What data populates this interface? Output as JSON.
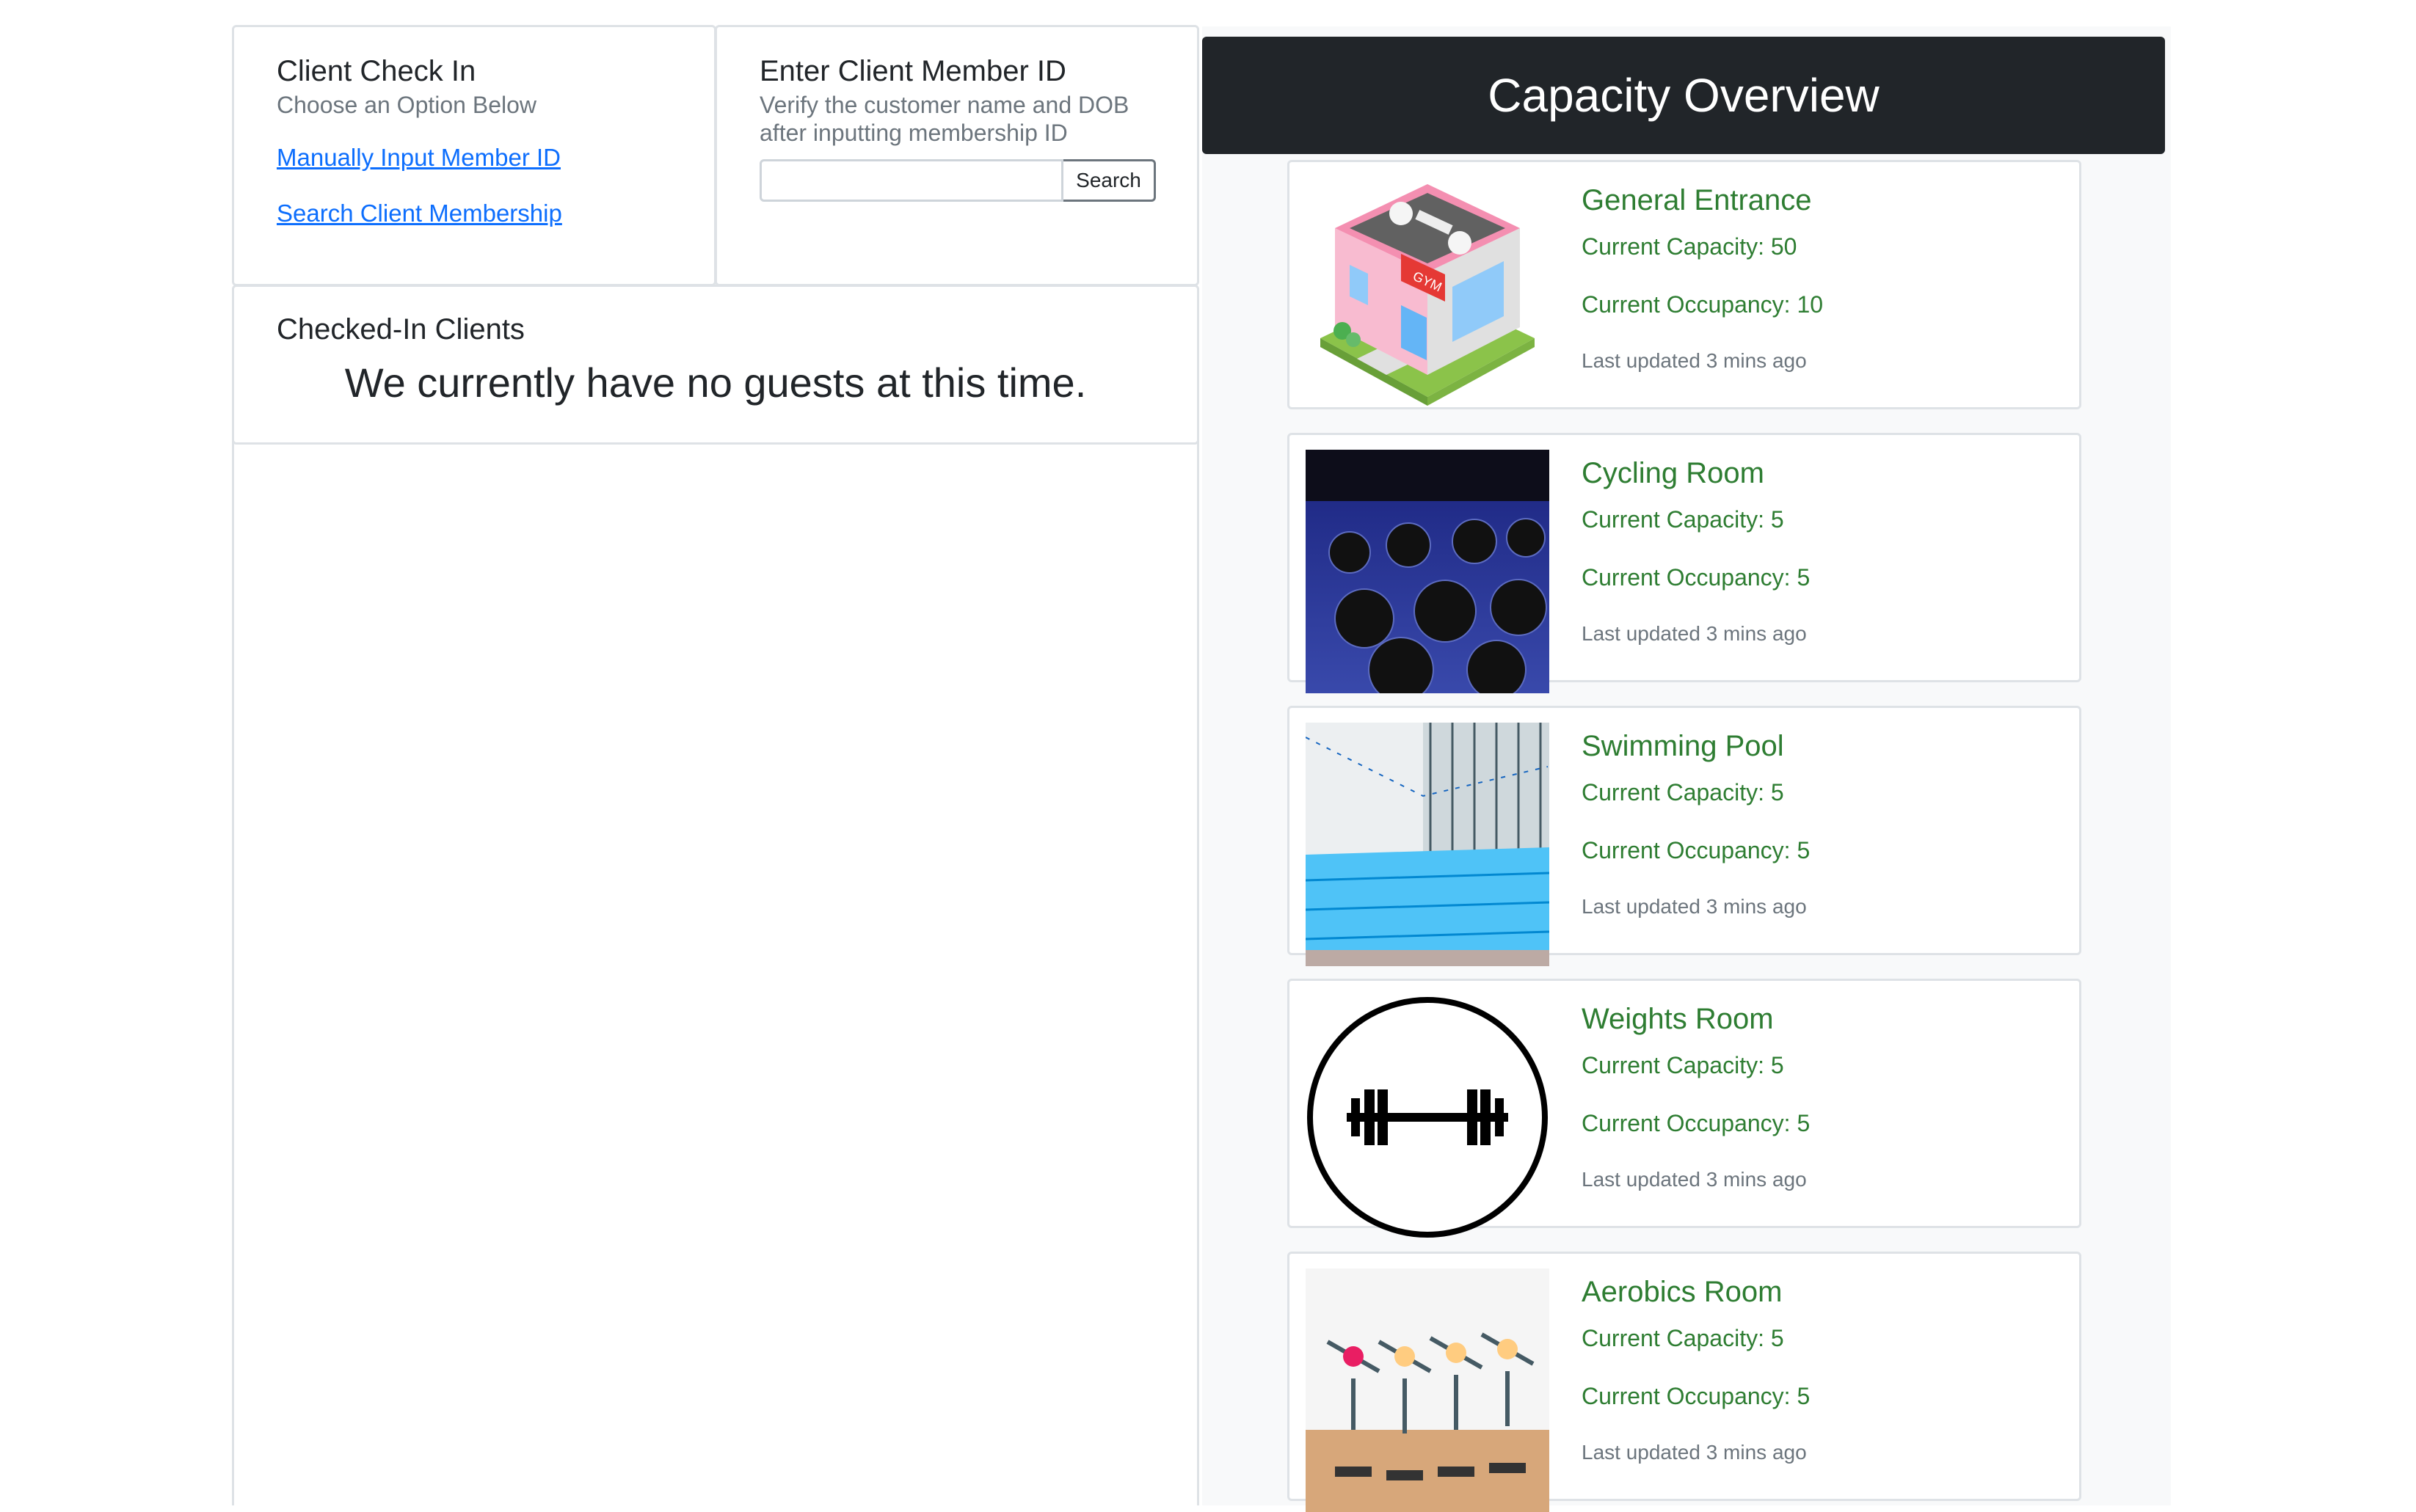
{
  "check_in": {
    "title": "Client Check In",
    "subtitle": "Choose an Option Below",
    "link_manual": "Manually Input Member ID",
    "link_search": "Search Client Membership"
  },
  "member_id": {
    "title": "Enter Client Member ID",
    "subtitle_line1": "Verify the customer name and DOB",
    "subtitle_line2": "after inputting membership ID",
    "input_value": "",
    "search_label": "Search"
  },
  "checked_in": {
    "title": "Checked-In Clients",
    "empty_message": "We currently have no guests at this time."
  },
  "capacity": {
    "header": "Capacity Overview",
    "rooms": [
      {
        "name": "General Entrance",
        "capacity": "Current Capacity: 50",
        "occupancy": "Current Occupancy: 10",
        "updated": "Last updated 3 mins ago",
        "icon": "gym-building-icon"
      },
      {
        "name": "Cycling Room",
        "capacity": "Current Capacity: 5",
        "occupancy": "Current Occupancy: 5",
        "updated": "Last updated 3 mins ago",
        "icon": "cycling-room-photo"
      },
      {
        "name": "Swimming Pool",
        "capacity": "Current Capacity: 5",
        "occupancy": "Current Occupancy: 5",
        "updated": "Last updated 3 mins ago",
        "icon": "swimming-pool-photo"
      },
      {
        "name": "Weights Room",
        "capacity": "Current Capacity: 5",
        "occupancy": "Current Occupancy: 5",
        "updated": "Last updated 3 mins ago",
        "icon": "barbell-icon"
      },
      {
        "name": "Aerobics Room",
        "capacity": "Current Capacity: 5",
        "occupancy": "Current Occupancy: 5",
        "updated": "Last updated 3 mins ago",
        "icon": "aerobics-class-photo"
      }
    ]
  },
  "colors": {
    "accent_green": "#2e7d32",
    "header_dark": "#212529",
    "link_blue": "#0d6efd"
  }
}
